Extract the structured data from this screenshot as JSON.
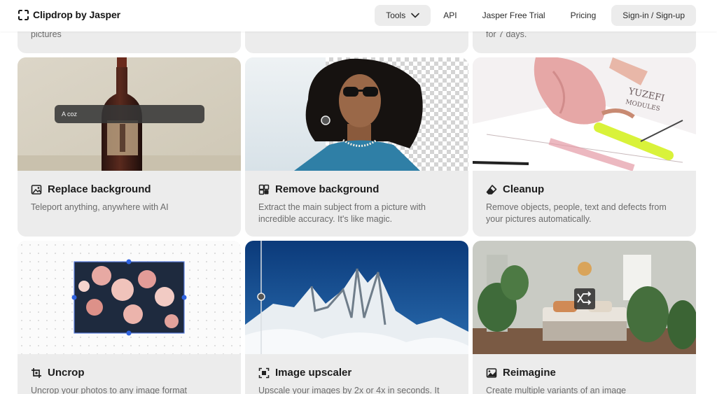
{
  "header": {
    "brand": "Clipdrop by Jasper",
    "nav": {
      "tools": "Tools",
      "api": "API",
      "trial": "Jasper Free Trial",
      "pricing": "Pricing",
      "signin": "Sign-in / Sign-up"
    }
  },
  "top_row": [
    "pictures",
    "",
    "for 7 days."
  ],
  "cards": [
    {
      "title": "Replace background",
      "desc": "Teleport anything, anywhere with AI",
      "prompt": "A coz",
      "icon": "replace-background-icon"
    },
    {
      "title": "Remove background",
      "desc": "Extract the main subject from a picture with incredible accuracy. It's like magic.",
      "icon": "remove-background-icon"
    },
    {
      "title": "Cleanup",
      "desc": "Remove objects, people, text and defects from your pictures automatically.",
      "icon": "eraser-icon"
    },
    {
      "title": "Uncrop",
      "desc": "Uncrop your photos to any image format",
      "icon": "crop-icon"
    },
    {
      "title": "Image upscaler",
      "desc": "Upscale your images by 2x or 4x in seconds. It",
      "icon": "upscale-icon"
    },
    {
      "title": "Reimagine",
      "desc": "Create multiple variants of an image",
      "icon": "image-icon"
    }
  ],
  "cleanup_paper_text": [
    "YUZEFI",
    "MODULES"
  ]
}
